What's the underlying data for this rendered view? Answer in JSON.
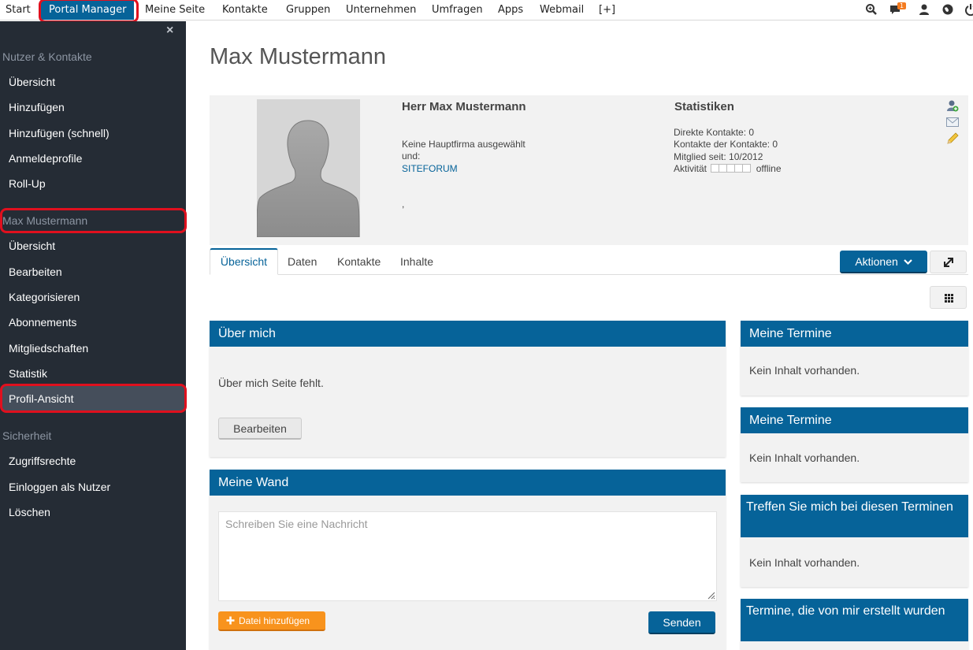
{
  "topnav": {
    "items": [
      "Start",
      "Portal Manager",
      "Meine Seite",
      "Kontakte",
      "Gruppen",
      "Unternehmen",
      "Umfragen",
      "Apps",
      "Webmail",
      "[+]"
    ],
    "notifications_count": "1",
    "icons": [
      "search-icon",
      "chat-icon",
      "user-icon",
      "globe-icon",
      "power-icon"
    ]
  },
  "sidebar": {
    "close": "×",
    "sections": [
      {
        "heading": "Nutzer & Kontakte",
        "items": [
          "Übersicht",
          "Hinzufügen",
          "Hinzufügen (schnell)",
          "Anmeldeprofile",
          "Roll-Up"
        ]
      },
      {
        "heading": "Max Mustermann",
        "items": [
          "Übersicht",
          "Bearbeiten",
          "Kategorisieren",
          "Abonnements",
          "Mitgliedschaften",
          "Statistik",
          "Profil-Ansicht"
        ]
      },
      {
        "heading": "Sicherheit",
        "items": [
          "Zugriffsrechte",
          "Einloggen als Nutzer",
          "Löschen"
        ]
      }
    ],
    "active_item": "Profil-Ansicht"
  },
  "page": {
    "title": "Max Mustermann"
  },
  "profile": {
    "name": "Herr Max Mustermann",
    "company_line1": "Keine Hauptfirma ausgewählt",
    "company_line2": "und:",
    "company_link": "SITEFORUM",
    "extra": ",",
    "stats_heading": "Statistiken",
    "direct_contacts": "Direkte Kontakte: 0",
    "contacts_of_contacts": "Kontakte der Kontakte: 0",
    "member_since": "Mitglied seit: 10/2012",
    "activity_label": "Aktivität",
    "activity_status": "offline",
    "actions_icons": [
      "add-contact-icon",
      "mail-icon",
      "edit-pencil-icon"
    ]
  },
  "tabs": [
    "Übersicht",
    "Daten",
    "Kontakte",
    "Inhalte"
  ],
  "active_tab": "Übersicht",
  "actions_button": "Aktionen",
  "about": {
    "heading": "Über mich",
    "text": "Über mich Seite fehlt.",
    "edit_button": "Bearbeiten"
  },
  "wall": {
    "heading": "Meine Wand",
    "placeholder": "Schreiben Sie eine Nachricht",
    "add_file_button": "Datei hinzufügen",
    "send_button": "Senden"
  },
  "side_panels": [
    {
      "heading": "Meine Termine",
      "text": "Kein Inhalt vorhanden."
    },
    {
      "heading": "Meine Termine",
      "text": "Kein Inhalt vorhanden."
    },
    {
      "heading": "Treffen Sie mich bei diesen Terminen",
      "text": "Kein Inhalt vorhanden."
    },
    {
      "heading": "Termine, die von mir erstellt wurden",
      "text": ""
    }
  ]
}
